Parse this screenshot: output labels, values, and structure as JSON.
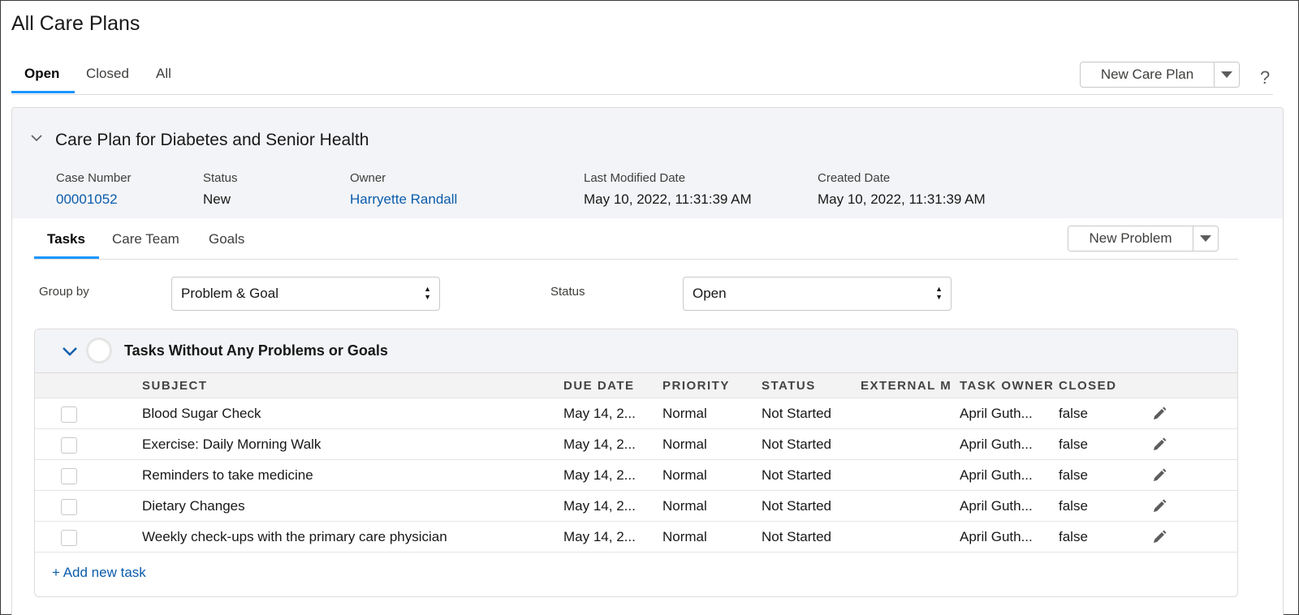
{
  "page": {
    "title": "All Care Plans"
  },
  "top_tabs": [
    {
      "label": "Open",
      "active": true
    },
    {
      "label": "Closed",
      "active": false
    },
    {
      "label": "All",
      "active": false
    }
  ],
  "new_care_plan_button": {
    "label": "New Care Plan"
  },
  "help_icon": {
    "glyph": "?"
  },
  "care_plan": {
    "title": "Care Plan for Diabetes and Senior Health",
    "fields": [
      {
        "label": "Case Number",
        "value": "00001052",
        "link": true
      },
      {
        "label": "Status",
        "value": "New",
        "link": false
      },
      {
        "label": "Owner",
        "value": "Harryette Randall",
        "link": true
      },
      {
        "label": "Last Modified Date",
        "value": "May 10, 2022, 11:31:39 AM",
        "link": false
      },
      {
        "label": "Created Date",
        "value": "May 10, 2022, 11:31:39 AM",
        "link": false
      }
    ]
  },
  "sub_tabs": [
    {
      "label": "Tasks",
      "active": true
    },
    {
      "label": "Care Team",
      "active": false
    },
    {
      "label": "Goals",
      "active": false
    }
  ],
  "new_problem_button": {
    "label": "New Problem"
  },
  "filters": {
    "group_by": {
      "label": "Group by",
      "value": "Problem & Goal"
    },
    "status": {
      "label": "Status",
      "value": "Open"
    }
  },
  "task_group": {
    "title": "Tasks Without Any Problems or Goals",
    "columns": [
      "SUBJECT",
      "DUE DATE",
      "PRIORITY",
      "STATUS",
      "EXTERNAL M",
      "TASK OWNER",
      "CLOSED"
    ],
    "rows": [
      {
        "subject": "Blood Sugar Check",
        "due_date": "May 14, 2...",
        "priority": "Normal",
        "status": "Not Started",
        "external": "",
        "owner": "April Guth...",
        "closed": "false"
      },
      {
        "subject": "Exercise: Daily Morning Walk",
        "due_date": "May 14, 2...",
        "priority": "Normal",
        "status": "Not Started",
        "external": "",
        "owner": "April Guth...",
        "closed": "false"
      },
      {
        "subject": "Reminders to take medicine",
        "due_date": "May 14, 2...",
        "priority": "Normal",
        "status": "Not Started",
        "external": "",
        "owner": "April Guth...",
        "closed": "false"
      },
      {
        "subject": "Dietary Changes",
        "due_date": "May 14, 2...",
        "priority": "Normal",
        "status": "Not Started",
        "external": "",
        "owner": "April Guth...",
        "closed": "false"
      },
      {
        "subject": "Weekly check-ups with the primary care physician",
        "due_date": "May 14, 2...",
        "priority": "Normal",
        "status": "Not Started",
        "external": "",
        "owner": "April Guth...",
        "closed": "false"
      }
    ],
    "add_task_label": "+ Add new task"
  },
  "colors": {
    "accent": "#1b96ff",
    "link": "#0b5cab",
    "header_bg": "#f3f4f7"
  }
}
